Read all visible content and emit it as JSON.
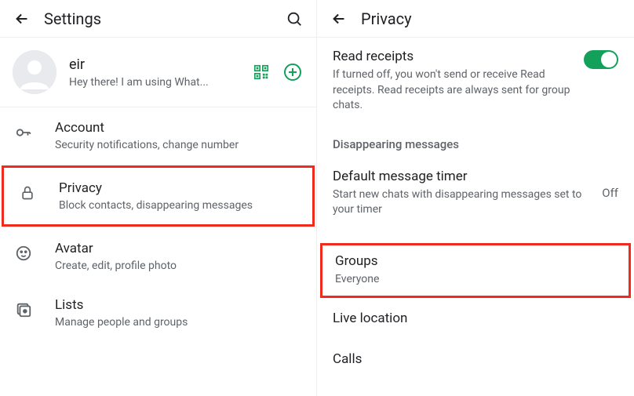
{
  "left": {
    "header": {
      "title": "Settings"
    },
    "profile": {
      "name": "eir",
      "status": "Hey there! I am using What..."
    },
    "items": [
      {
        "title": "Account",
        "subtitle": "Security notifications, change number"
      },
      {
        "title": "Privacy",
        "subtitle": "Block contacts, disappearing messages"
      },
      {
        "title": "Avatar",
        "subtitle": "Create, edit, profile photo"
      },
      {
        "title": "Lists",
        "subtitle": "Manage people and groups"
      }
    ]
  },
  "right": {
    "header": {
      "title": "Privacy"
    },
    "readReceipts": {
      "title": "Read receipts",
      "subtitle": "If turned off, you won't send or receive Read receipts. Read receipts are always sent for group chats."
    },
    "sectionHeader": "Disappearing messages",
    "defaultTimer": {
      "title": "Default message timer",
      "subtitle": "Start new chats with disappearing messages set to your timer",
      "value": "Off"
    },
    "groups": {
      "title": "Groups",
      "subtitle": "Everyone"
    },
    "liveLocation": {
      "title": "Live location"
    },
    "calls": {
      "title": "Calls"
    }
  }
}
